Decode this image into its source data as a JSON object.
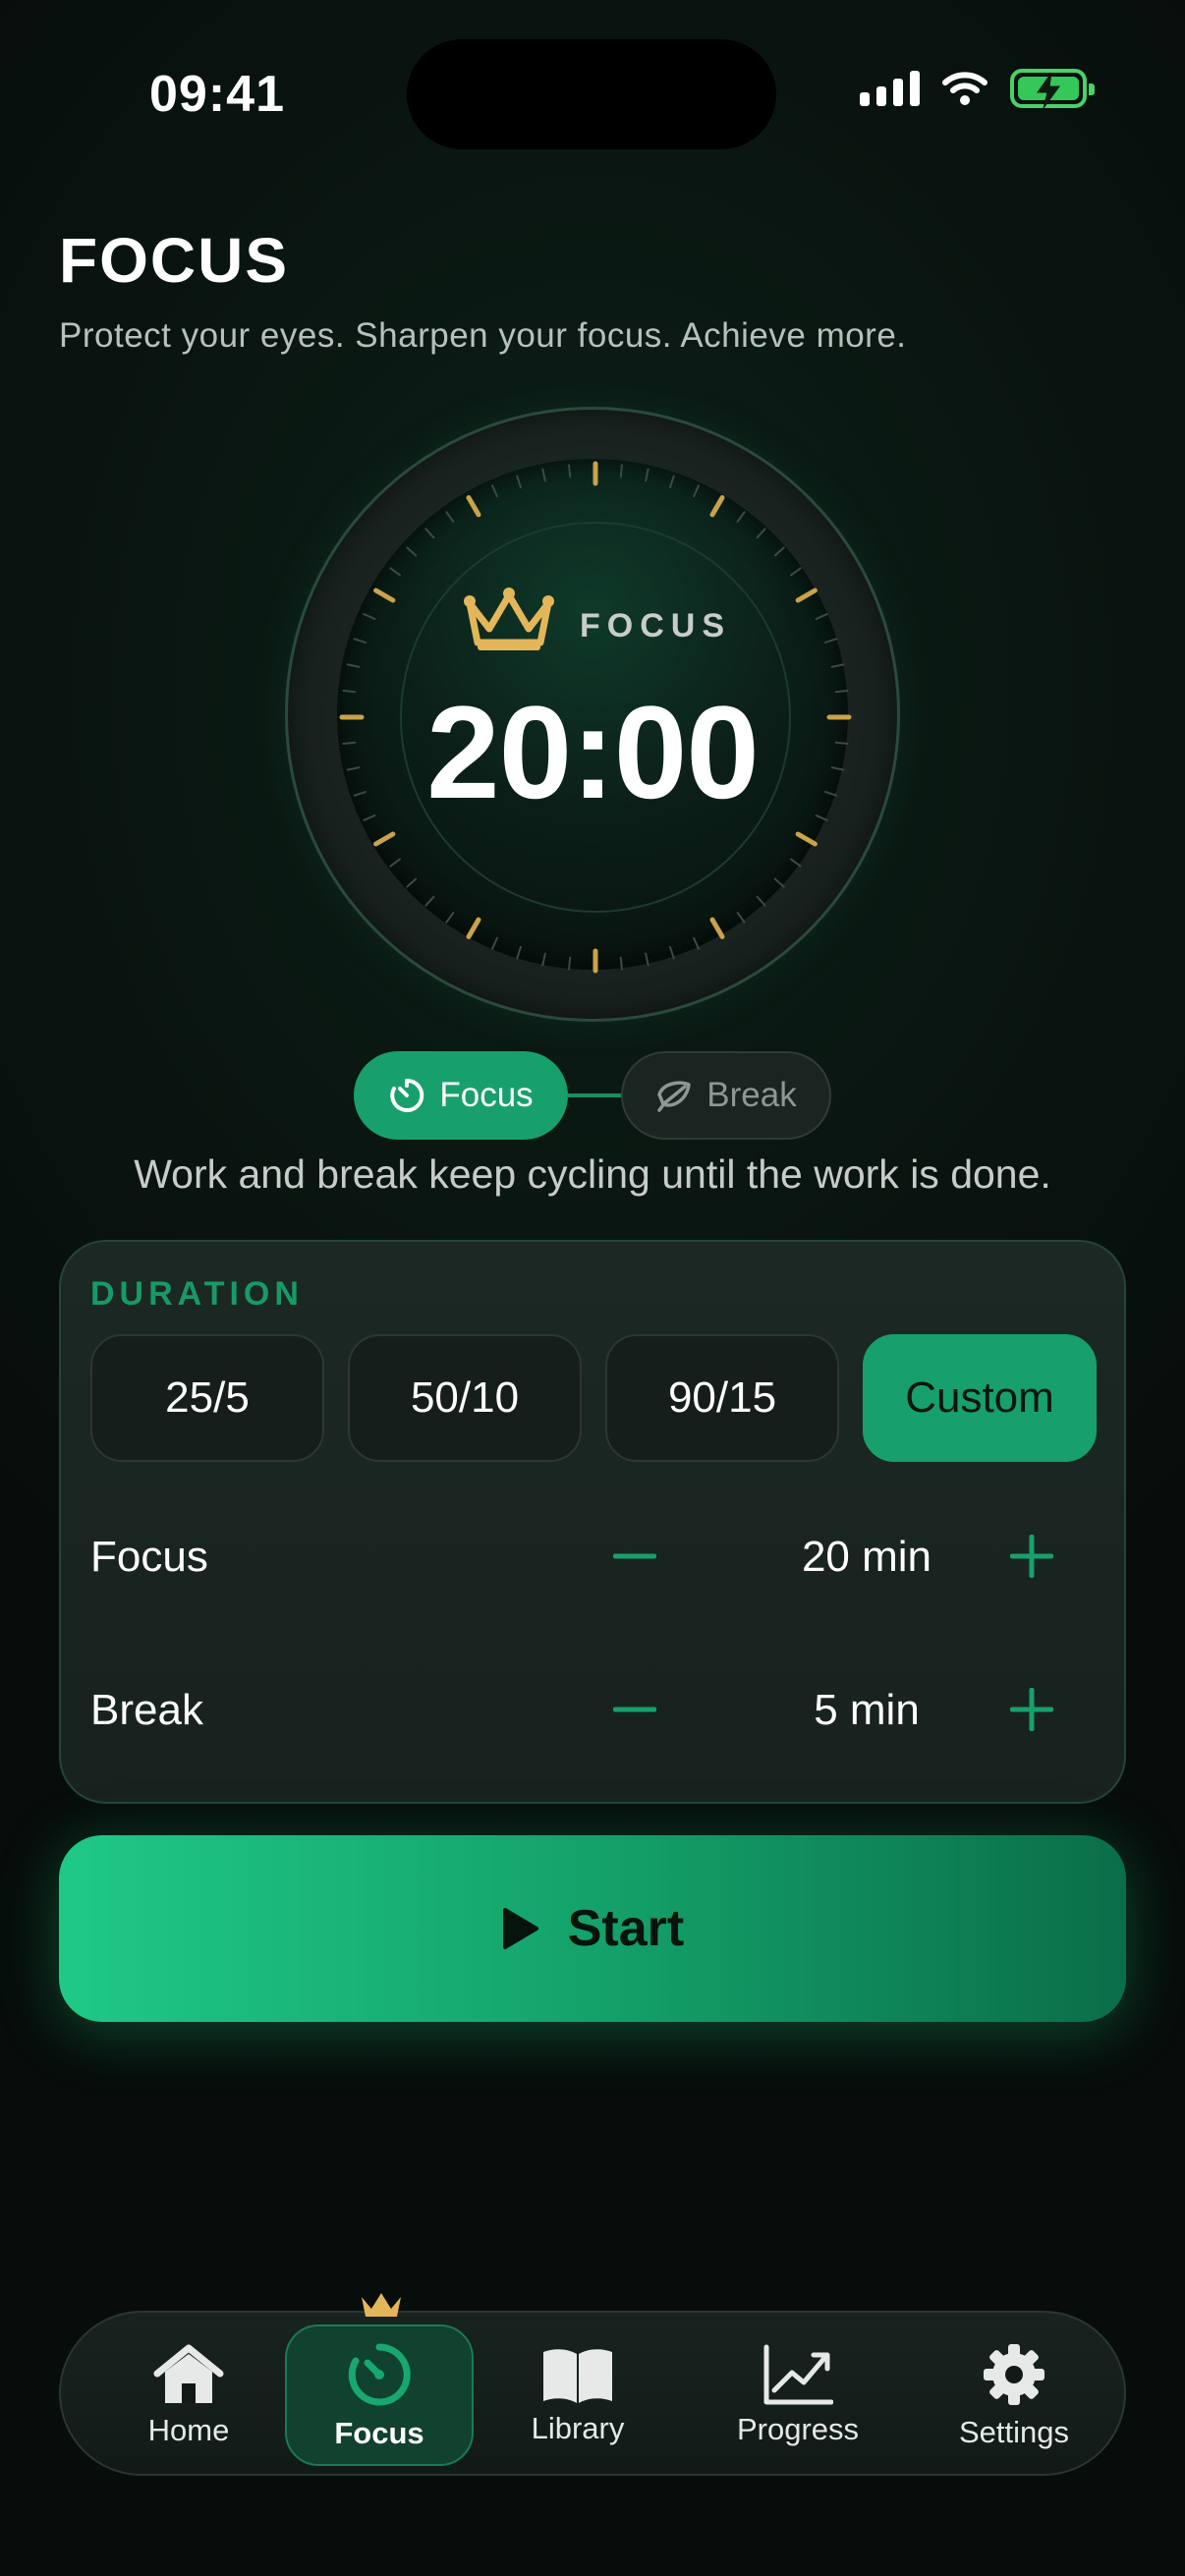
{
  "status_bar": {
    "time": "09:41"
  },
  "header": {
    "title": "FOCUS",
    "subtitle": "Protect your eyes. Sharpen your focus. Achieve more."
  },
  "dial": {
    "label": "FOCUS",
    "time": "20:00",
    "icon": "crown-icon"
  },
  "mode_toggle": {
    "focus_label": "Focus",
    "break_label": "Break",
    "active": "Focus"
  },
  "cycle_text": "Work and break keep cycling until the work is done.",
  "duration": {
    "label": "DURATION",
    "presets": [
      "25/5",
      "50/10",
      "90/15",
      "Custom"
    ],
    "active_preset": "Custom",
    "focus": {
      "label": "Focus",
      "value": "20 min"
    },
    "break": {
      "label": "Break",
      "value": "5 min"
    }
  },
  "start_button": {
    "label": "Start"
  },
  "tabs": [
    {
      "label": "Home",
      "icon": "home-icon"
    },
    {
      "label": "Focus",
      "icon": "timer-icon"
    },
    {
      "label": "Library",
      "icon": "book-icon"
    },
    {
      "label": "Progress",
      "icon": "chart-icon"
    },
    {
      "label": "Settings",
      "icon": "gear-icon"
    }
  ],
  "colors": {
    "accent": "#17a06b",
    "background": "#0a1712",
    "tick": "#c9a24a"
  }
}
